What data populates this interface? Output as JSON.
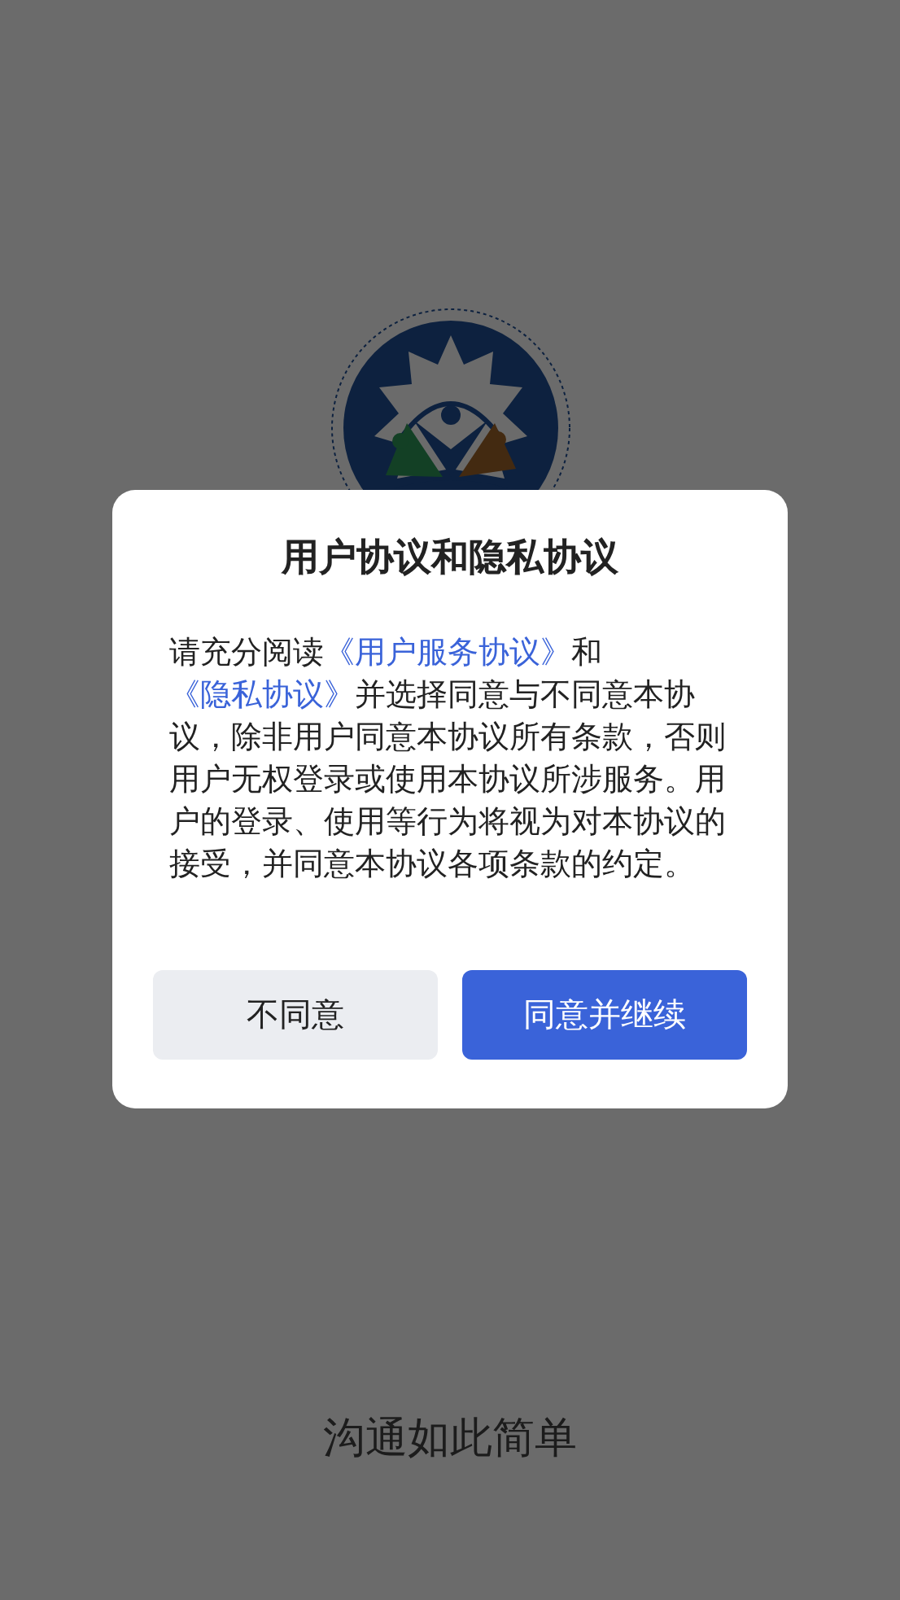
{
  "background": {
    "slogan": "沟通如此简单"
  },
  "dialog": {
    "title": "用户协议和隐私协议",
    "message": [
      {
        "kind": "text",
        "text": "请充分阅读"
      },
      {
        "kind": "link",
        "text": "《用户服务协议》"
      },
      {
        "kind": "text",
        "text": "和"
      },
      {
        "kind": "link",
        "text": "《隐私协议》"
      },
      {
        "kind": "text",
        "text": "并选择同意与不同意本协议，除非用户同意本协议所有条款，否则用户无权登录或使用本协议所涉服务。用户的登录、使用等行为将视为对本协议的接受，并同意本协议各项条款的约定。"
      }
    ],
    "buttons": [
      {
        "label": "不同意",
        "kind": "secondary"
      },
      {
        "label": "同意并继续",
        "kind": "primary"
      }
    ]
  }
}
